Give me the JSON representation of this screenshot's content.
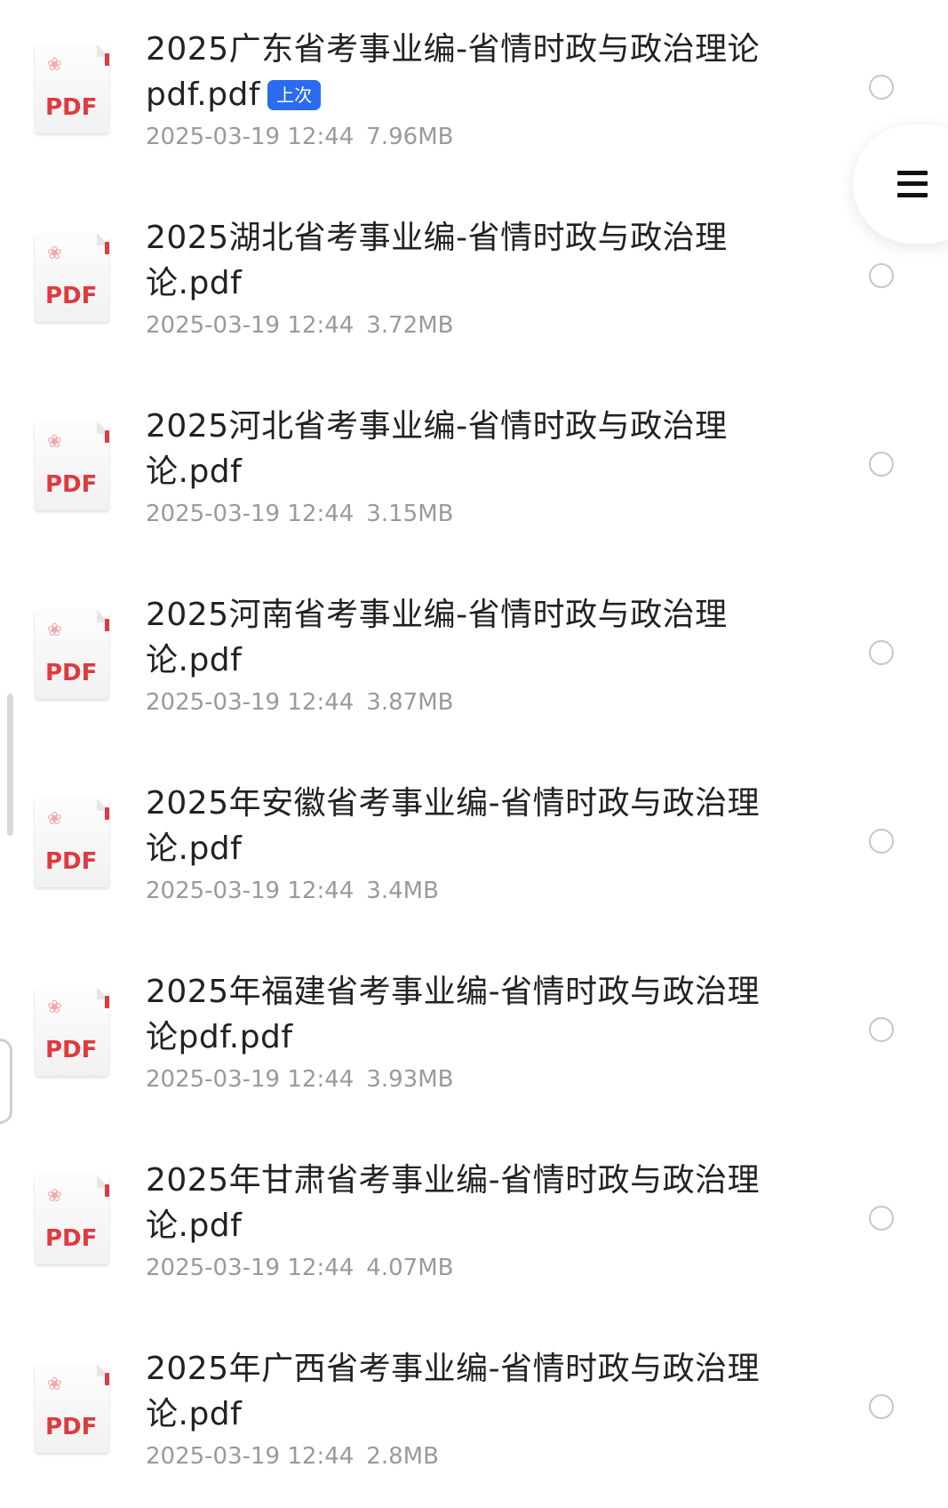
{
  "files": [
    {
      "name": "2025广东省考事业编-省情时政与政治理论pdf.pdf",
      "date": "2025-03-19 12:44",
      "size": "7.96MB",
      "badge": "上次"
    },
    {
      "name": "2025湖北省考事业编-省情时政与政治理论.pdf",
      "date": "2025-03-19 12:44",
      "size": "3.72MB"
    },
    {
      "name": "2025河北省考事业编-省情时政与政治理论.pdf",
      "date": "2025-03-19 12:44",
      "size": "3.15MB"
    },
    {
      "name": "2025河南省考事业编-省情时政与政治理论.pdf",
      "date": "2025-03-19 12:44",
      "size": "3.87MB"
    },
    {
      "name": "2025年安徽省考事业编-省情时政与政治理论.pdf",
      "date": "2025-03-19 12:44",
      "size": "3.4MB"
    },
    {
      "name": "2025年福建省考事业编-省情时政与政治理论pdf.pdf",
      "date": "2025-03-19 12:44",
      "size": "3.93MB"
    },
    {
      "name": "2025年甘肃省考事业编-省情时政与政治理论.pdf",
      "date": "2025-03-19 12:44",
      "size": "4.07MB"
    },
    {
      "name": "2025年广西省考事业编-省情时政与政治理论.pdf",
      "date": "2025-03-19 12:44",
      "size": "2.8MB"
    }
  ],
  "file_icon": {
    "label": "PDF",
    "icon": "pdf-file-icon"
  },
  "menu": {
    "icon": "hamburger-menu-icon"
  },
  "colors": {
    "pdf_red": "#e0393e",
    "badge_blue": "#2a6bf2",
    "title_text": "#222222",
    "meta_text": "#9a9a9a",
    "radio_border": "#c6c6c6"
  }
}
